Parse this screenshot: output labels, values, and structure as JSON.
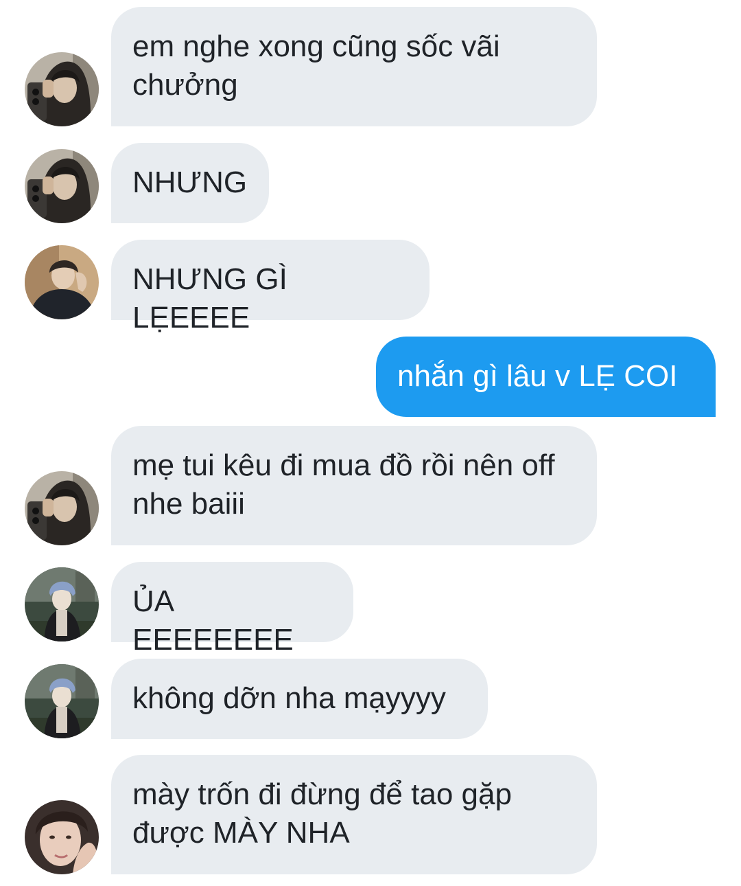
{
  "colors": {
    "incoming_bubble": "#e8ecf0",
    "outgoing_bubble": "#1d9bf0",
    "incoming_text": "#1f2328",
    "outgoing_text": "#ffffff"
  },
  "messages": [
    {
      "direction": "incoming",
      "avatar": "avatar-hooded-selfie",
      "text": "em nghe xong cũng sốc vãi chưởng"
    },
    {
      "direction": "incoming",
      "avatar": "avatar-hooded-selfie",
      "text": "NHƯNG"
    },
    {
      "direction": "incoming",
      "avatar": "avatar-boy-dark-jacket",
      "text": "NHƯNG GÌ LẸEEEE"
    },
    {
      "direction": "outgoing",
      "avatar": null,
      "text": "nhắn gì lâu v LẸ COI"
    },
    {
      "direction": "incoming",
      "avatar": "avatar-hooded-selfie",
      "text": "mẹ tui kêu đi mua đồ rồi nên off nhe baiii"
    },
    {
      "direction": "incoming",
      "avatar": "avatar-blue-hat-park",
      "text": "ỦA EEEEEEEE"
    },
    {
      "direction": "incoming",
      "avatar": "avatar-blue-hat-park",
      "text": "không dỡn nha mạyyyy"
    },
    {
      "direction": "incoming",
      "avatar": "avatar-hand-on-face",
      "text": "mày trốn đi đừng để tao gặp được MÀY NHA"
    }
  ]
}
